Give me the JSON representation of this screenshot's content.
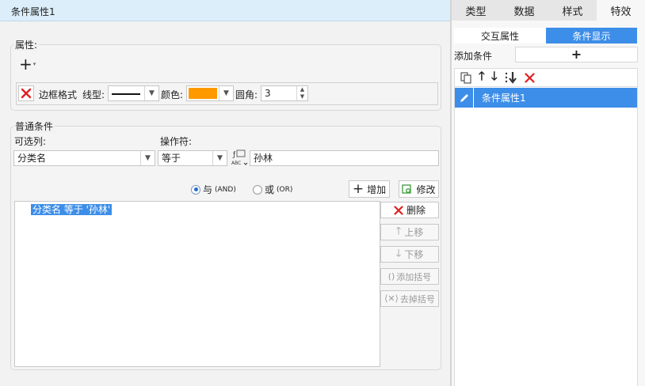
{
  "left_panel": {
    "title": "条件属性1",
    "properties": {
      "legend": "属性:",
      "border_format_label": "边框格式",
      "line_type_label": "线型:",
      "color_label": "颜色:",
      "color_value": "#ff9900",
      "radius_label": "圆角:",
      "radius_value": "3"
    },
    "conditions": {
      "legend": "普通条件",
      "column_label": "可选列:",
      "column_value": "分类名",
      "operator_label": "操作符:",
      "operator_value": "等于",
      "value": "孙林",
      "and_label": "与",
      "and_sub": "(AND)",
      "or_label": "或",
      "or_sub": "(OR)",
      "and_selected": true,
      "add_label": "增加",
      "edit_label": "修改",
      "delete_label": "删除",
      "move_up_label": "上移",
      "move_down_label": "下移",
      "add_bracket_label": "添加括号",
      "remove_bracket_label": "去掉括号",
      "list_items": [
        "分类名 等于 '孙林'"
      ]
    }
  },
  "right_panel": {
    "tabs": [
      "类型",
      "数据",
      "样式",
      "特效"
    ],
    "active_tab": "特效",
    "subtabs": [
      "交互属性",
      "条件显示"
    ],
    "active_subtab": "条件显示",
    "add_condition_label": "添加条件",
    "add_symbol": "+",
    "conditions": [
      "条件属性1"
    ]
  },
  "colors": {
    "accent": "#3d8ee8",
    "selection": "#3d8ee8",
    "delete_red": "#e02020"
  }
}
